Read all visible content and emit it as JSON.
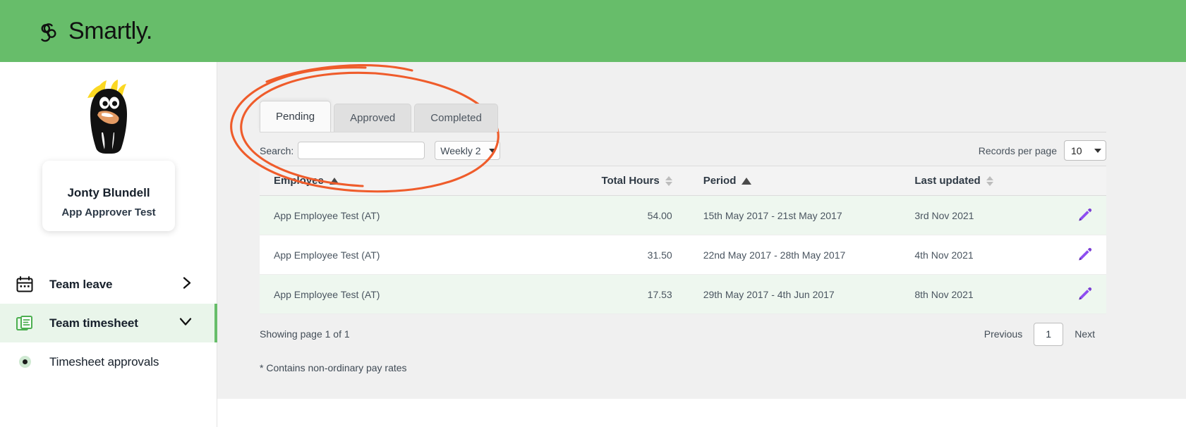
{
  "header": {
    "brand": "Smartly.",
    "logo_icon": "smartly-s-logo",
    "bg_color": "#67bd6a"
  },
  "sidebar": {
    "avatar_icon": "rockhopper-penguin-avatar",
    "user": {
      "name": "Jonty Blundell",
      "role": "App Approver Test"
    },
    "items": [
      {
        "label": "Team leave",
        "icon": "calendar-icon",
        "chevron": "chevron-right-icon",
        "active": false
      },
      {
        "label": "Team timesheet",
        "icon": "document-stack-icon",
        "chevron": "chevron-down-icon",
        "active": true
      }
    ],
    "sub_items": [
      {
        "label": "Timesheet approvals",
        "icon": "bullet-dot-icon",
        "active": false
      }
    ]
  },
  "main": {
    "tabs": [
      {
        "label": "Pending",
        "active": true
      },
      {
        "label": "Approved",
        "active": false
      },
      {
        "label": "Completed",
        "active": false
      }
    ],
    "controls": {
      "search_label": "Search:",
      "search_value": "",
      "search_placeholder": "",
      "period_select_value": "Weekly 2",
      "records_per_page_label": "Records per page",
      "records_per_page_value": "10"
    },
    "table": {
      "columns": [
        {
          "label": "Employee",
          "sort": "asc",
          "align": "left"
        },
        {
          "label": "Total Hours",
          "sort": "none",
          "align": "right"
        },
        {
          "label": "Period",
          "sort": "asc",
          "align": "left"
        },
        {
          "label": "Last updated",
          "sort": "none",
          "align": "left"
        },
        {
          "label": "",
          "sort": "none",
          "align": "right"
        }
      ],
      "rows": [
        {
          "employee": "App Employee Test (AT)",
          "total_hours": "54.00",
          "period": "15th May 2017 - 21st May 2017",
          "last_updated": "3rd Nov 2021",
          "action_icon": "edit-pencil-icon"
        },
        {
          "employee": "App Employee Test (AT)",
          "total_hours": "31.50",
          "period": "22nd May 2017 - 28th May 2017",
          "last_updated": "4th Nov 2021",
          "action_icon": "edit-pencil-icon"
        },
        {
          "employee": "App Employee Test (AT)",
          "total_hours": "17.53",
          "period": "29th May 2017 - 4th Jun 2017",
          "last_updated": "8th Nov 2021",
          "action_icon": "edit-pencil-icon"
        }
      ]
    },
    "footer": {
      "showing": "Showing page 1 of 1",
      "previous_label": "Previous",
      "page_number": "1",
      "next_label": "Next",
      "note": "* Contains non-ordinary pay rates"
    }
  },
  "annotation": {
    "shape": "hand-drawn-ellipse",
    "color": "#ef5c2b"
  }
}
